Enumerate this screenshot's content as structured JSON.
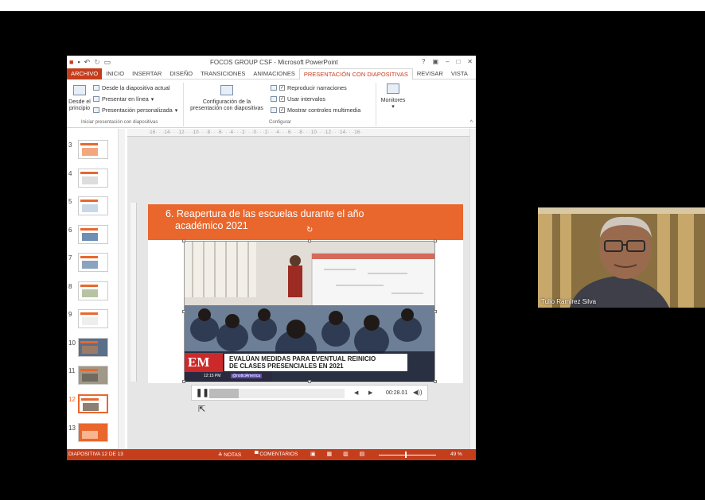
{
  "window": {
    "title": "FOCOS GROUP CSF - Microsoft PowerPoint",
    "controls": [
      "?",
      "▣",
      "–",
      "□",
      "✕"
    ]
  },
  "tabs": [
    {
      "label": "ARCHIVO",
      "state": "file"
    },
    {
      "label": "INICIO",
      "state": "normal"
    },
    {
      "label": "INSERTAR",
      "state": "normal"
    },
    {
      "label": "DISEÑO",
      "state": "normal"
    },
    {
      "label": "TRANSICIONES",
      "state": "normal"
    },
    {
      "label": "ANIMACIONES",
      "state": "normal"
    },
    {
      "label": "PRESENTACIÓN CON DIAPOSITIVAS",
      "state": "active"
    },
    {
      "label": "REVISAR",
      "state": "normal"
    },
    {
      "label": "VISTA",
      "state": "normal"
    }
  ],
  "ribbon": {
    "from_start_line1": "Desde el",
    "from_start_line2": "principio",
    "from_current": "Desde la diapositiva actual",
    "present_online": "Presentar en línea",
    "custom_show": "Presentación personalizada",
    "group_start": "Iniciar presentación con diapositivas",
    "setup_line1": "Configuración de la",
    "setup_line2": "presentación con diapositivas",
    "play_narrations": "Reproducir narraciones",
    "use_timings": "Usar intervalos",
    "show_media_controls": "Mostrar controles multimedia",
    "group_setup": "Configurar",
    "monitors": "Monitores"
  },
  "ruler": "·16·  ·  ·14·  ·  ·12·  ·  ·10·  ·  ·8·  ·  ·6·  ·  ·4·  ·  ·2·  ·  ·0·  ·  ·2·  ·  ·4·  ·  ·6·  ·  ·8·  ·  ·10·  ·  ·12·  ·  ·14·  ·  ·16·",
  "thumbnails": [
    "3",
    "4",
    "5",
    "6",
    "7",
    "8",
    "9",
    "10",
    "11",
    "12",
    "13"
  ],
  "selected_thumbnail": "12",
  "slide": {
    "title_line1": "6. Reapertura de las escuelas durante el año",
    "title_line2": "académico 2021",
    "news_logo": "EM",
    "headline_line1": "EVALÚAN MEDIDAS PARA EVENTUAL REINICIO",
    "headline_line2": "DE CLASES PRESENCIALES EN 2021",
    "clock": "12:15 PM",
    "handle": "@noticiAmerica"
  },
  "media": {
    "pause_glyph": "❚❚",
    "back_glyph": "◀",
    "forward_glyph": "▶",
    "time": "00:28.01",
    "volume_glyph": "◀))",
    "progress": 0.22
  },
  "status": {
    "slide_indicator": "DIAPOSITIVA 12 DE 13",
    "notes": "≙ NOTAS",
    "comments": "▀ COMENTARIOS",
    "views": "▣ ▦ ▥ ▤",
    "zoom": "49 %",
    "zoom_fraction": 0.49
  },
  "webcam": {
    "name": "Tulio Ramírez Silva"
  },
  "colors": {
    "accent": "#C43E1C",
    "slide_orange": "#E9672D"
  }
}
